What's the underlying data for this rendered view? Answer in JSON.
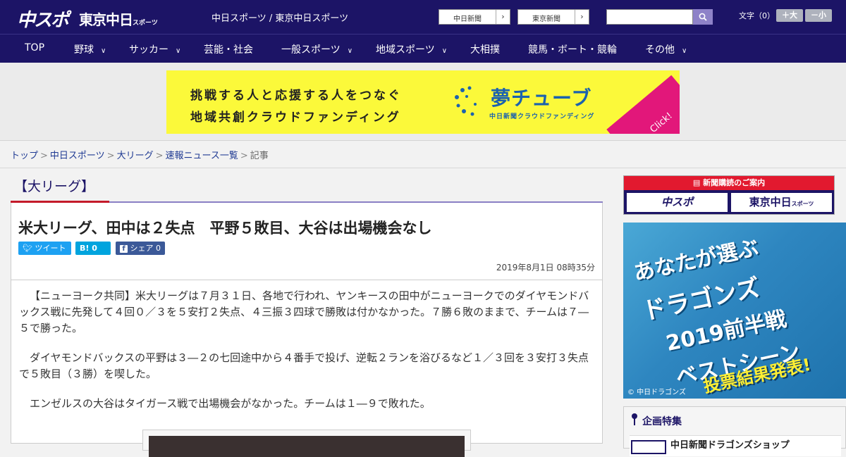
{
  "header": {
    "logo_chuspo": "中スポ",
    "logo_tokyo": "東京中日",
    "logo_tokyo_suffix": "スポーツ",
    "site_title": "中日スポーツ / 東京中日スポーツ",
    "paper_links": [
      {
        "label": "中日新聞",
        "arrow": "›"
      },
      {
        "label": "東京新聞",
        "arrow": "›"
      }
    ],
    "search": {
      "value": "",
      "icon": "search-icon"
    },
    "font_size": {
      "label": "文字（0）",
      "increase": "＋大",
      "decrease": "－小"
    }
  },
  "nav": {
    "items": [
      {
        "label": "TOP",
        "has_menu": false
      },
      {
        "label": "野球",
        "has_menu": true
      },
      {
        "label": "サッカー",
        "has_menu": true
      },
      {
        "label": "芸能・社会",
        "has_menu": false
      },
      {
        "label": "一般スポーツ",
        "has_menu": true
      },
      {
        "label": "地域スポーツ",
        "has_menu": true
      },
      {
        "label": "大相撲",
        "has_menu": false
      },
      {
        "label": "競馬・ボート・競輪",
        "has_menu": false
      },
      {
        "label": "その他",
        "has_menu": true
      }
    ],
    "chevron": "∨"
  },
  "banner": {
    "line1": "挑戦する人と応援する人をつなぐ",
    "line2": "地域共創クラウドファンディング",
    "brand": "夢チューブ",
    "brand_sub": "中日新聞クラウドファンディング",
    "click": "Click!"
  },
  "breadcrumb": {
    "items": [
      "トップ",
      "中日スポーツ",
      "大リーグ",
      "速報ニュース一覧"
    ],
    "current": "記事",
    "separator": ">"
  },
  "article": {
    "category": "【大リーグ】",
    "headline": "米大リーグ、田中は２失点　平野５敗目、大谷は出場機会なし",
    "share": {
      "tweet": "ツイート",
      "hatena": "B!",
      "hatena_count": "0",
      "facebook": "シェア",
      "facebook_count": "0"
    },
    "date": "2019年8月1日 08時35分",
    "paragraphs": [
      "【ニューヨーク共同】米大リーグは７月３１日、各地で行われ、ヤンキースの田中がニューヨークでのダイヤモンドバックス戦に先発して４回０／３を５安打２失点、４三振３四球で勝敗は付かなかった。７勝６敗のままで、チームは７―５で勝った。",
      "ダイヤモンドバックスの平野は３―２の七回途中から４番手で投げ、逆転２ランを浴びるなど１／３回を３安打３失点で５敗目（３勝）を喫した。",
      "エンゼルスの大谷はタイガース戦で出場機会がなかった。チームは１―９で敗れた。"
    ]
  },
  "sidebar": {
    "subscribe_title": "新聞購読のご案内",
    "subscribe_chuspo": "中スポ",
    "subscribe_tokyo": "東京中日",
    "subscribe_tokyo_suffix": "スポーツ",
    "promo_lines": [
      "あなたが選ぶ",
      "ドラゴンズ",
      "2019前半戦",
      "ベストシーン"
    ],
    "promo_result": "投票結果発表!",
    "promo_credit": "© 中日ドラゴンズ",
    "feature_title": "企画特集",
    "feature_item": "中日新聞ドラゴンズショップ"
  },
  "colors": {
    "header_bg": "#1c1466",
    "accent_red": "#c41a2a",
    "banner_yellow": "#fbf93a",
    "banner_blue": "#1b62ae",
    "twitter": "#1da1f2",
    "hatena": "#00a4de",
    "facebook": "#3b5998"
  }
}
